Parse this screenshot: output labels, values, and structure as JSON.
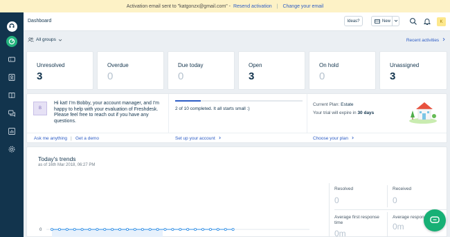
{
  "notice": {
    "message": "Activation email sent to \"katgonzx@gmail.com\" -",
    "resend": "Resend activation",
    "divider": "|",
    "change": "Change your email"
  },
  "nav": {
    "items": [
      "logo-icon",
      "dashboard-icon",
      "tickets-icon",
      "contacts-icon",
      "solutions-icon",
      "forums-icon",
      "reports-icon",
      "admin-icon"
    ]
  },
  "header": {
    "title": "Dashboard",
    "ideas_label": "Ideas?",
    "new_label": "New",
    "avatar_initial": "K"
  },
  "subheader": {
    "groups_label": "All groups",
    "recent_label": "Recent activities"
  },
  "stats": [
    {
      "label": "Unresolved",
      "value": "3"
    },
    {
      "label": "Overdue",
      "value": "0"
    },
    {
      "label": "Due today",
      "value": "0"
    },
    {
      "label": "Open",
      "value": "3"
    },
    {
      "label": "On hold",
      "value": "0"
    },
    {
      "label": "Unassigned",
      "value": "3"
    }
  ],
  "onboarding": {
    "avatar_initial": "B",
    "message": "Hi kat! I'm Bobby, your account manager, and I'm happy to help with your evaluation of Freshdesk. Please feel free to reach out if you have any questions.",
    "link_ask": "Ask me anything",
    "link_demo": "Get a demo",
    "progress_text": "2 of 10 completed. It all starts small :)",
    "progress_fraction": 0.2,
    "setup_link": "Set up your account",
    "plan_label": "Current Plan:",
    "plan_name": "Estate",
    "trial_text": "Your trial will expire in",
    "trial_days": "30 days",
    "choose_plan": "Choose your plan"
  },
  "trends": {
    "title": "Today's trends",
    "subtitle": "as of 16th Mar 2018, 06:27 PM",
    "zero_label": "0",
    "stats": [
      {
        "label": "Resolved",
        "value": "0"
      },
      {
        "label": "Received",
        "value": "0"
      },
      {
        "label": "Average first response time",
        "value": "0m"
      },
      {
        "label": "Average respons",
        "value": "0m"
      }
    ]
  },
  "colors": {
    "nav_bg": "#12344d",
    "accent_green": "#24b47e",
    "link_blue": "#2c5cc5",
    "notice_bg": "#fdf2c6",
    "chart_line": "#2c8ce5"
  }
}
